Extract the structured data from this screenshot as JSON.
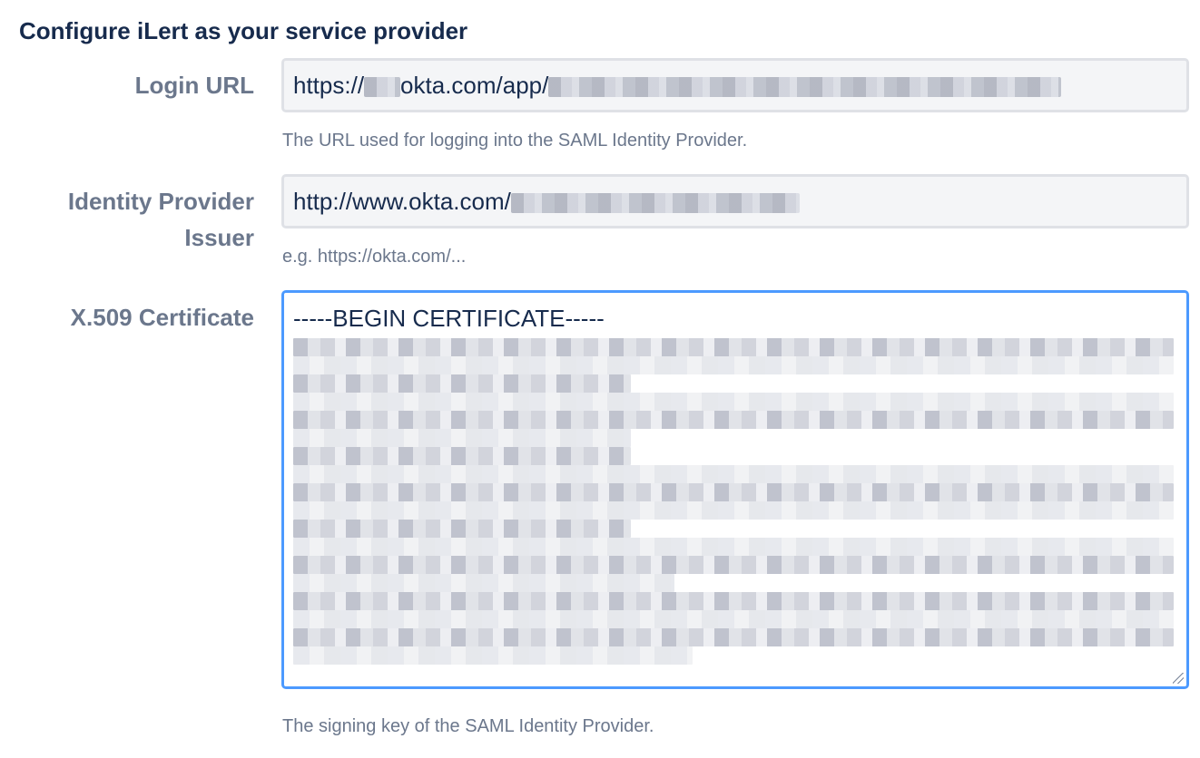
{
  "section": {
    "title": "Configure iLert as your service provider"
  },
  "login_url": {
    "label": "Login URL",
    "value_prefix": "https://",
    "value_mid": "okta.com/app/",
    "help": "The URL used for logging into the SAML Identity Provider."
  },
  "idp_issuer": {
    "label_line1": "Identity Provider",
    "label_line2": "Issuer",
    "value_prefix": "http://www.okta.com/",
    "help": "e.g. https://okta.com/..."
  },
  "certificate": {
    "label": "X.509 Certificate",
    "first_line": "-----BEGIN CERTIFICATE-----",
    "help": "The signing key of the SAML Identity Provider."
  },
  "colors": {
    "title": "#172b4d",
    "label": "#6b778c",
    "input_bg": "#f4f5f7",
    "input_border": "#dfe1e6",
    "focus_border": "#4c9aff"
  }
}
